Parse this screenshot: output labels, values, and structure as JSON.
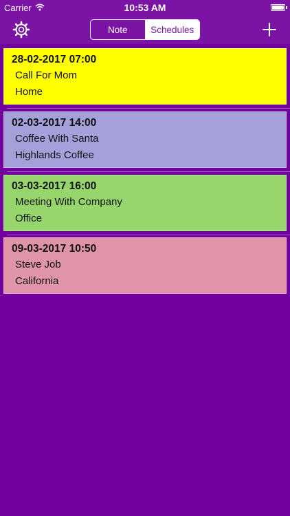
{
  "status_bar": {
    "carrier": "Carrier",
    "time": "10:53 AM",
    "wifi_icon": "wifi-icon",
    "battery_icon": "battery-icon"
  },
  "nav": {
    "settings_icon": "gear-icon",
    "segments": [
      "Note",
      "Schedules"
    ],
    "selected_segment": "Schedules",
    "add_icon": "plus-icon"
  },
  "schedules": [
    {
      "date": "28-02-2017 07:00",
      "title": "Call For Mom",
      "location": "Home",
      "color": "#FFFF00"
    },
    {
      "date": "02-03-2017 14:00",
      "title": "Coffee With Santa",
      "location": "Highlands Coffee",
      "color": "#A5A0DA"
    },
    {
      "date": "03-03-2017 16:00",
      "title": "Meeting With Company",
      "location": "Office",
      "color": "#97D56D"
    },
    {
      "date": "09-03-2017 10:50",
      "title": "Steve Job",
      "location": "California",
      "color": "#E094AA"
    }
  ],
  "colors": {
    "background": "#72009F",
    "bar": "#7B14A4",
    "accent": "#FFFFFF"
  }
}
